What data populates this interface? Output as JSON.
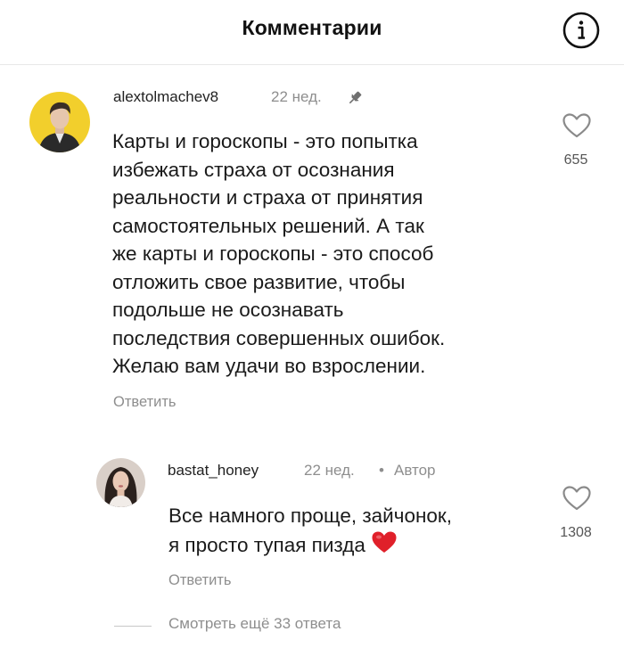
{
  "header": {
    "title": "Комментарии",
    "info_icon": "info-icon"
  },
  "comments": [
    {
      "username": "alextolmachev8",
      "time": "22 нед.",
      "pinned": true,
      "lines": [
        "Карты и гороскопы - это попытка",
        "избежать страха от осознания",
        "реальности и страха от принятия",
        "самостоятельных решений. А так",
        "же карты и гороскопы - это способ",
        "отложить свое развитие, чтобы",
        "подольше не осознавать",
        "последствия совершенных ошибок.",
        "Желаю вам удачи во взрослении."
      ],
      "reply_label": "Ответить",
      "likes": "655"
    }
  ],
  "reply": {
    "username": "bastat_honey",
    "time": "22 нед.",
    "separator": "•",
    "author_badge": "Автор",
    "lines": [
      "Все намного проще, зайчонок,",
      "я просто тупая пизда"
    ],
    "emoji": "red-heart-icon",
    "reply_label": "Ответить",
    "likes": "1308"
  },
  "view_more": {
    "label": "Смотреть ещё 33 ответа"
  },
  "colors": {
    "avatar1_bg": "#f2cf2c",
    "heart_red": "#e0202a",
    "muted_text": "#8e8e8e"
  }
}
